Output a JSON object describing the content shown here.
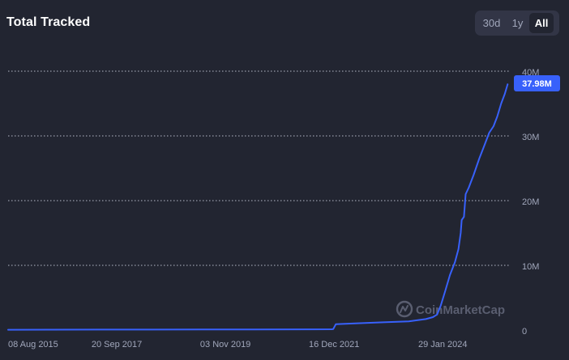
{
  "header": {
    "title": "Total Tracked",
    "ranges": [
      {
        "label": "30d",
        "active": false
      },
      {
        "label": "1y",
        "active": false
      },
      {
        "label": "All",
        "active": true
      }
    ]
  },
  "watermark": "CoinMarketCap",
  "colors": {
    "background": "#222531",
    "line": "#3861fb",
    "badge": "#3861fb",
    "tick_text": "#a1a7bb"
  },
  "chart_data": {
    "type": "line",
    "title": "Total Tracked",
    "y_ticks": [
      {
        "value": 0,
        "label": "0"
      },
      {
        "value": 10000000,
        "label": "10M"
      },
      {
        "value": 20000000,
        "label": "20M"
      },
      {
        "value": 30000000,
        "label": "30M"
      },
      {
        "value": 40000000,
        "label": "40M"
      }
    ],
    "x_ticks": [
      {
        "date": "2015-08-08",
        "label": "08 Aug 2015"
      },
      {
        "date": "2017-09-20",
        "label": "20 Sep 2017"
      },
      {
        "date": "2019-11-03",
        "label": "03 Nov 2019"
      },
      {
        "date": "2021-12-16",
        "label": "16 Dec 2021"
      },
      {
        "date": "2024-01-29",
        "label": "29 Jan 2024"
      }
    ],
    "xlim": [
      "2015-08-08",
      "2025-05-15"
    ],
    "ylim": [
      0,
      40000000
    ],
    "grid": true,
    "last_value_label": "37.98M",
    "series": [
      {
        "x": [
          "2015-08-08",
          "2016-06-01",
          "2017-06-01",
          "2018-06-01",
          "2019-06-01",
          "2020-06-01",
          "2021-06-01",
          "2021-12-01",
          "2021-12-10",
          "2021-12-28",
          "2022-06-01",
          "2022-12-01",
          "2023-06-01",
          "2023-10-01",
          "2023-11-20",
          "2023-12-20",
          "2024-01-15",
          "2024-02-15",
          "2024-03-20",
          "2024-04-25",
          "2024-05-20",
          "2024-06-05",
          "2024-06-12",
          "2024-06-28",
          "2024-07-10",
          "2024-08-01",
          "2024-09-05",
          "2024-10-15",
          "2024-11-20",
          "2024-12-25",
          "2025-01-25",
          "2025-02-20",
          "2025-03-20",
          "2025-04-15",
          "2025-05-05"
        ],
        "values": [
          50000,
          60000,
          70000,
          80000,
          90000,
          100000,
          110000,
          120000,
          150000,
          900000,
          1050000,
          1200000,
          1350000,
          1700000,
          2000000,
          2400000,
          3800000,
          6000000,
          8500000,
          10500000,
          12500000,
          15000000,
          17000000,
          17500000,
          21000000,
          22000000,
          24000000,
          26500000,
          28500000,
          30500000,
          31500000,
          33000000,
          35000000,
          36500000,
          37980000
        ]
      }
    ]
  }
}
